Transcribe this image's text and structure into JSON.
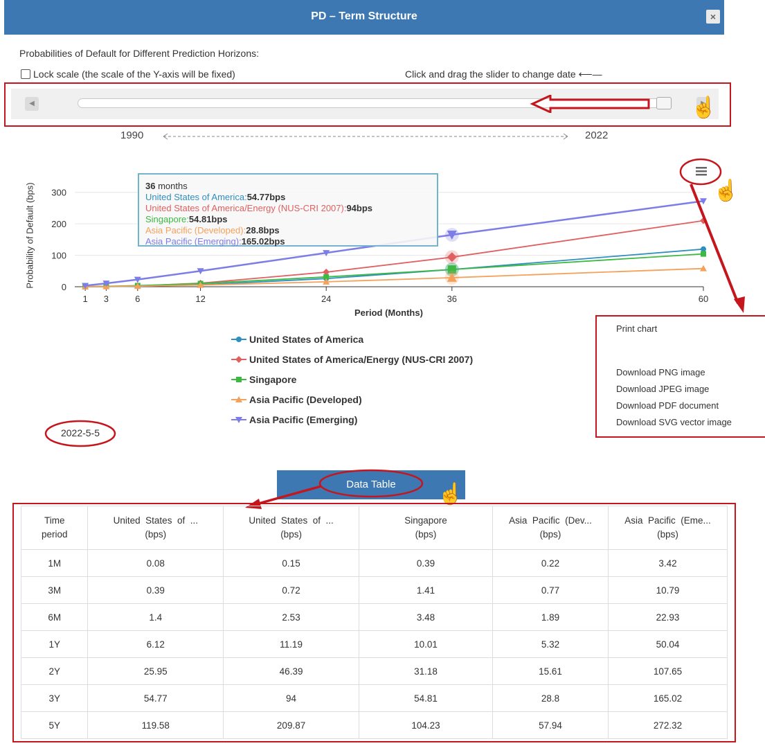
{
  "dialog": {
    "title": "PD – Term Structure",
    "close_label": "×",
    "subtitle": "Probabilities of Default for Different Prediction Horizons:",
    "lock_label": "Lock scale (the scale of the Y-axis will be fixed)",
    "drag_hint": "Click and drag the slider to change date ⟵—",
    "slider": {
      "start_year": "1990",
      "end_year": "2022",
      "position_fraction": 1.0,
      "left_btn": "◀",
      "right_btn": "▶"
    },
    "current_date": "2022-5-5",
    "data_table_button": "Data Table"
  },
  "chart_data": {
    "type": "line",
    "xlabel": "Period (Months)",
    "ylabel": "Probability of Default (bps)",
    "x": [
      1,
      3,
      6,
      12,
      24,
      36,
      60
    ],
    "x_ticks": [
      "1",
      "3",
      "6",
      "12",
      "24",
      "36",
      "60"
    ],
    "y_ticks": [
      "0",
      "100",
      "200",
      "300"
    ],
    "ylim": [
      0,
      300
    ],
    "grid": true,
    "series": [
      {
        "name": "United States of America",
        "color": "#2f8fbf",
        "marker": "circle",
        "values": [
          0.08,
          0.39,
          1.4,
          6.12,
          25.95,
          54.77,
          119.58
        ]
      },
      {
        "name": "United States of America/Energy (NUS-CRI 2007)",
        "color": "#e06060",
        "marker": "diamond",
        "values": [
          0.15,
          0.72,
          2.53,
          11.19,
          46.39,
          94,
          209.87
        ]
      },
      {
        "name": "Singapore",
        "color": "#3cb843",
        "marker": "square",
        "values": [
          0.39,
          1.41,
          3.48,
          10.01,
          31.18,
          54.81,
          104.23
        ]
      },
      {
        "name": "Asia Pacific (Developed)",
        "color": "#f5a15a",
        "marker": "triangle",
        "values": [
          0.22,
          0.77,
          1.89,
          5.32,
          15.61,
          28.8,
          57.94
        ]
      },
      {
        "name": "Asia Pacific (Emerging)",
        "color": "#7c7de6",
        "marker": "triangle-down",
        "values": [
          3.42,
          10.79,
          22.93,
          50.04,
          107.65,
          165.02,
          272.32
        ]
      }
    ],
    "tooltip": {
      "header_num": "36",
      "header_unit": "months",
      "lines": [
        {
          "label": "United States of America:",
          "value": "54.77bps",
          "color": "#2f8fbf"
        },
        {
          "label": "United States of America/Energy (NUS-CRI 2007):",
          "value": "94bps",
          "color": "#e06060"
        },
        {
          "label": "Singapore:",
          "value": "54.81bps",
          "color": "#3cb843"
        },
        {
          "label": "Asia Pacific (Developed):",
          "value": "28.8bps",
          "color": "#f5a15a"
        },
        {
          "label": "Asia Pacific (Emerging):",
          "value": "165.02bps",
          "color": "#7c7de6"
        }
      ]
    },
    "legend": "bottom-center"
  },
  "export_menu": {
    "items": [
      "Print chart",
      "Download PNG image",
      "Download JPEG image",
      "Download PDF document",
      "Download SVG vector image"
    ]
  },
  "table": {
    "headers": [
      [
        "Time",
        "period"
      ],
      [
        "United  States  of  ...",
        "(bps)"
      ],
      [
        "United  States  of  ...",
        "(bps)"
      ],
      [
        "Singapore",
        "(bps)"
      ],
      [
        "Asia  Pacific  (Dev...",
        "(bps)"
      ],
      [
        "Asia  Pacific  (Eme...",
        "(bps)"
      ]
    ],
    "rows": [
      [
        "1M",
        "0.08",
        "0.15",
        "0.39",
        "0.22",
        "3.42"
      ],
      [
        "3M",
        "0.39",
        "0.72",
        "1.41",
        "0.77",
        "10.79"
      ],
      [
        "6M",
        "1.4",
        "2.53",
        "3.48",
        "1.89",
        "22.93"
      ],
      [
        "1Y",
        "6.12",
        "11.19",
        "10.01",
        "5.32",
        "50.04"
      ],
      [
        "2Y",
        "25.95",
        "46.39",
        "31.18",
        "15.61",
        "107.65"
      ],
      [
        "3Y",
        "54.77",
        "94",
        "54.81",
        "28.8",
        "165.02"
      ],
      [
        "5Y",
        "119.58",
        "209.87",
        "104.23",
        "57.94",
        "272.32"
      ]
    ]
  },
  "icons": {
    "menu": "hamburger-icon",
    "cursor": "hand-pointer-icon"
  }
}
